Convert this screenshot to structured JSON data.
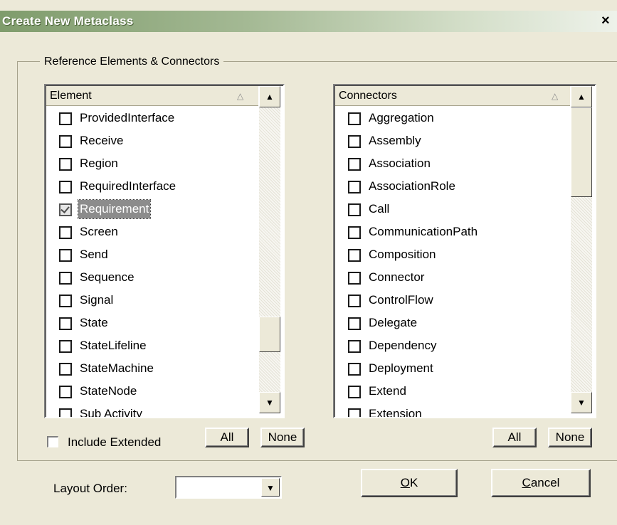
{
  "window": {
    "title": "Create New Metaclass",
    "close_glyph": "×"
  },
  "group": {
    "label": "Reference Elements & Connectors"
  },
  "element_list": {
    "header": "Element",
    "items": [
      {
        "label": "ProvidedInterface",
        "checked": false
      },
      {
        "label": "Receive",
        "checked": false
      },
      {
        "label": "Region",
        "checked": false
      },
      {
        "label": "RequiredInterface",
        "checked": false
      },
      {
        "label": "Requirement",
        "checked": true,
        "selected": true
      },
      {
        "label": "Screen",
        "checked": false
      },
      {
        "label": "Send",
        "checked": false
      },
      {
        "label": "Sequence",
        "checked": false
      },
      {
        "label": "Signal",
        "checked": false
      },
      {
        "label": "State",
        "checked": false
      },
      {
        "label": "StateLifeline",
        "checked": false
      },
      {
        "label": "StateMachine",
        "checked": false
      },
      {
        "label": "StateNode",
        "checked": false
      },
      {
        "label": "Sub Activity",
        "checked": false
      }
    ]
  },
  "connector_list": {
    "header": "Connectors",
    "items": [
      {
        "label": "Aggregation",
        "checked": false
      },
      {
        "label": "Assembly",
        "checked": false
      },
      {
        "label": "Association",
        "checked": false
      },
      {
        "label": "AssociationRole",
        "checked": false
      },
      {
        "label": "Call",
        "checked": false
      },
      {
        "label": "CommunicationPath",
        "checked": false
      },
      {
        "label": "Composition",
        "checked": false
      },
      {
        "label": "Connector",
        "checked": false
      },
      {
        "label": "ControlFlow",
        "checked": false
      },
      {
        "label": "Delegate",
        "checked": false
      },
      {
        "label": "Dependency",
        "checked": false
      },
      {
        "label": "Deployment",
        "checked": false
      },
      {
        "label": "Extend",
        "checked": false
      },
      {
        "label": "Extension",
        "checked": false
      }
    ]
  },
  "include_extended": {
    "label": "Include Extended",
    "checked": false
  },
  "buttons": {
    "all": "All",
    "none": "None",
    "ok_mnemonic": "O",
    "ok_rest": "K",
    "cancel_mnemonic": "C",
    "cancel_rest": "ancel"
  },
  "layout_order": {
    "label": "Layout Order:",
    "value": ""
  },
  "icons": {
    "sort": "△",
    "up": "▲",
    "down": "▼"
  }
}
